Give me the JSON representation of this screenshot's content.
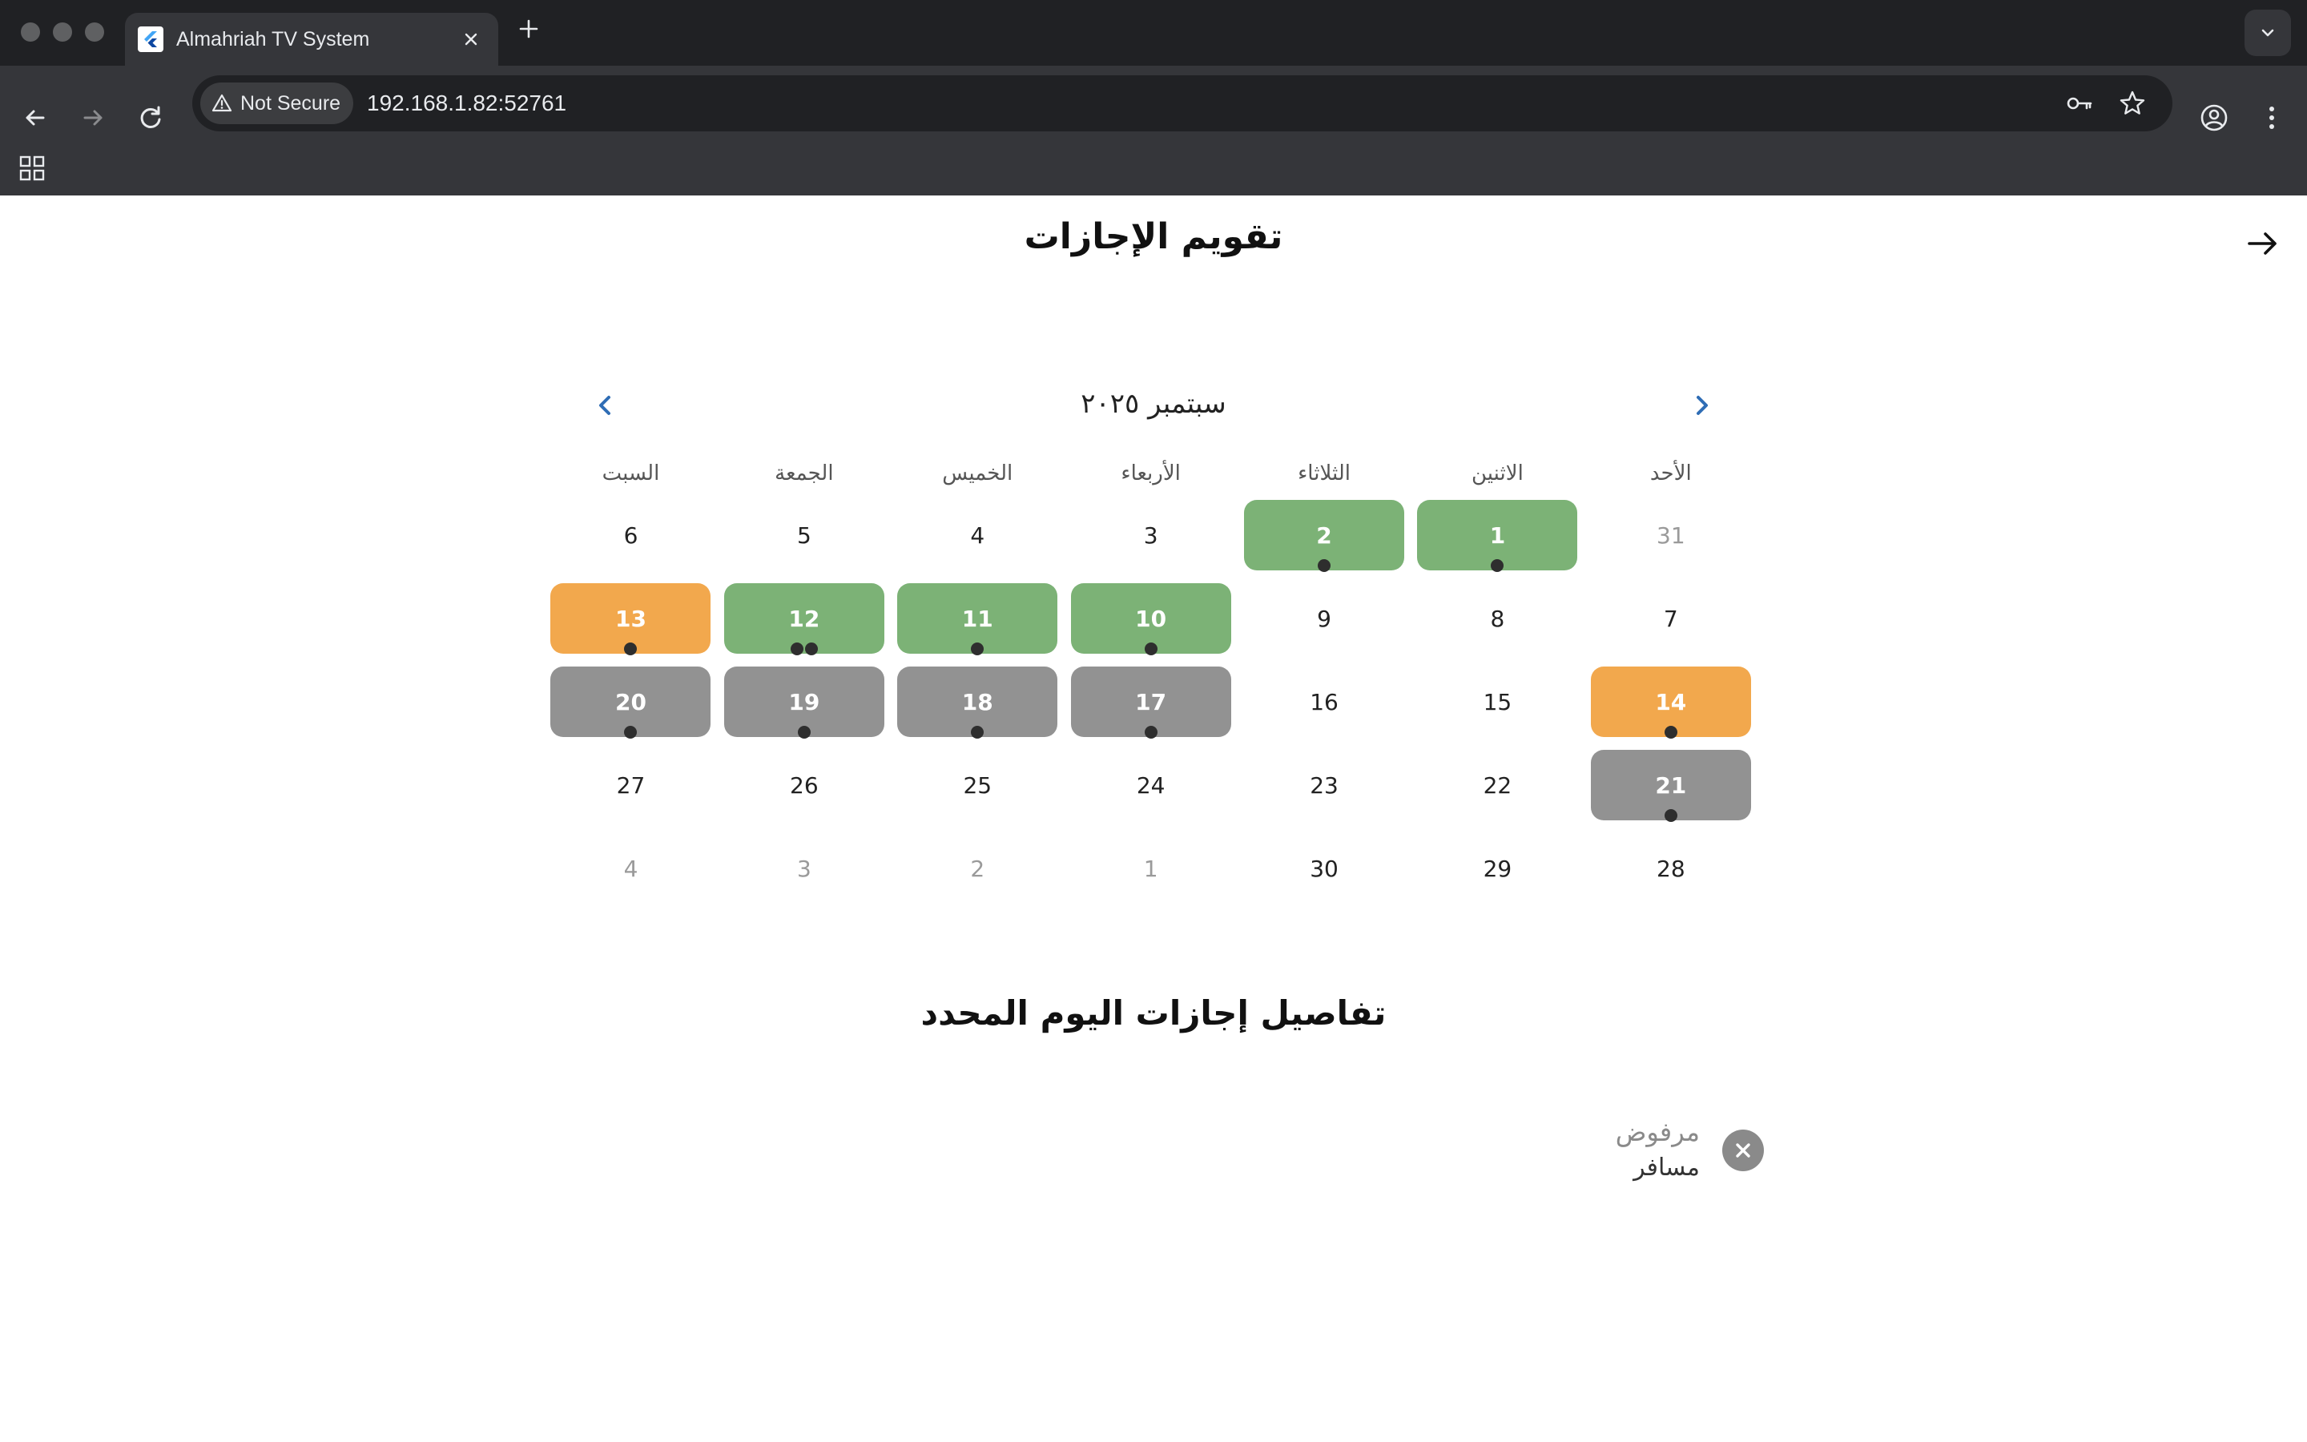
{
  "browser": {
    "tab_title": "Almahriah TV System",
    "security_label": "Not Secure",
    "url": "192.168.1.82:52761"
  },
  "page": {
    "title": "تقويم الإجازات",
    "month_label": "سبتمبر ٢٠٢٥",
    "weekdays": [
      "الأحد",
      "الاثنين",
      "الثلاثاء",
      "الأربعاء",
      "الخميس",
      "الجمعة",
      "السبت"
    ],
    "weeks": [
      [
        {
          "day": "31",
          "state": "out",
          "dots": 0
        },
        {
          "day": "1",
          "state": "approved",
          "dots": 1
        },
        {
          "day": "2",
          "state": "approved",
          "dots": 1
        },
        {
          "day": "3",
          "state": "normal",
          "dots": 0
        },
        {
          "day": "4",
          "state": "normal",
          "dots": 0
        },
        {
          "day": "5",
          "state": "normal",
          "dots": 0
        },
        {
          "day": "6",
          "state": "normal",
          "dots": 0
        }
      ],
      [
        {
          "day": "7",
          "state": "normal",
          "dots": 0
        },
        {
          "day": "8",
          "state": "normal",
          "dots": 0
        },
        {
          "day": "9",
          "state": "normal",
          "dots": 0
        },
        {
          "day": "10",
          "state": "approved",
          "dots": 1
        },
        {
          "day": "11",
          "state": "approved",
          "dots": 1
        },
        {
          "day": "12",
          "state": "approved",
          "dots": 2
        },
        {
          "day": "13",
          "state": "pending",
          "dots": 1
        }
      ],
      [
        {
          "day": "14",
          "state": "pending",
          "dots": 1
        },
        {
          "day": "15",
          "state": "normal",
          "dots": 0
        },
        {
          "day": "16",
          "state": "normal",
          "dots": 0
        },
        {
          "day": "17",
          "state": "rejected",
          "dots": 1
        },
        {
          "day": "18",
          "state": "rejected",
          "dots": 1
        },
        {
          "day": "19",
          "state": "rejected",
          "dots": 1
        },
        {
          "day": "20",
          "state": "rejected",
          "dots": 1
        }
      ],
      [
        {
          "day": "21",
          "state": "rejected",
          "dots": 1
        },
        {
          "day": "22",
          "state": "normal",
          "dots": 0
        },
        {
          "day": "23",
          "state": "normal",
          "dots": 0
        },
        {
          "day": "24",
          "state": "normal",
          "dots": 0
        },
        {
          "day": "25",
          "state": "normal",
          "dots": 0
        },
        {
          "day": "26",
          "state": "normal",
          "dots": 0
        },
        {
          "day": "27",
          "state": "normal",
          "dots": 0
        }
      ],
      [
        {
          "day": "28",
          "state": "normal",
          "dots": 0
        },
        {
          "day": "29",
          "state": "normal",
          "dots": 0
        },
        {
          "day": "30",
          "state": "normal",
          "dots": 0
        },
        {
          "day": "1",
          "state": "out",
          "dots": 0
        },
        {
          "day": "2",
          "state": "out",
          "dots": 0
        },
        {
          "day": "3",
          "state": "out",
          "dots": 0
        },
        {
          "day": "4",
          "state": "out",
          "dots": 0
        }
      ]
    ],
    "details_title": "تفاصيل إجازات اليوم المحدد",
    "leave": {
      "status": "مرفوض",
      "type": "مسافر",
      "icon": "close-circle-icon"
    }
  },
  "colors": {
    "approved": "#7cb276",
    "pending": "#f2a84d",
    "rejected": "#929292",
    "nav_arrow": "#2f6db5"
  }
}
